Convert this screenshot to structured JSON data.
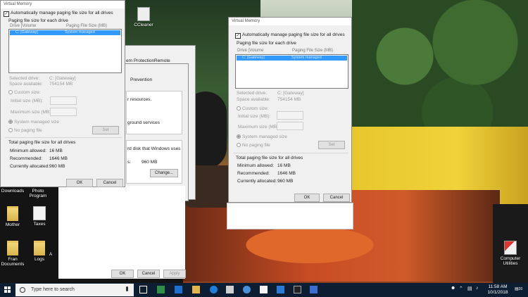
{
  "desktop": {
    "icons": [
      {
        "label": "CCleaner"
      },
      {
        "label": "Downloads"
      },
      {
        "label": "Photo Program"
      },
      {
        "label": "Mother"
      },
      {
        "label": "Taxes"
      },
      {
        "label": "Fran Documents"
      },
      {
        "label": "Logs"
      },
      {
        "label": "A"
      },
      {
        "label": "Computer Utilities"
      }
    ]
  },
  "vm_left": {
    "title": "Virtual Memory",
    "auto_manage": "Automatically manage paging file size for all drives",
    "group_label": "Paging file size for each drive",
    "col_drive": "Drive [Volume",
    "col_size": "Paging File Size (MB)",
    "list_drive": "C: [Gateway]",
    "list_size": "System managed",
    "selected_drive_label": "Selected drive:",
    "selected_drive_value": "C: [Gateway]",
    "space_label": "Space available:",
    "space_value": "754154 MB",
    "custom_size": "Custom size:",
    "initial_size": "Initial size (MB):",
    "max_size": "Maximum size (MB):",
    "system_managed": "System managed size",
    "no_paging": "No paging file",
    "set": "Set",
    "total_label": "Total paging file size for all drives",
    "min_label": "Minimum allowed:",
    "min_value": "16 MB",
    "rec_label": "Recommended:",
    "rec_value": "1646 MB",
    "alloc_label": "Currently allocated:",
    "alloc_value": "960 MB",
    "ok": "OK",
    "cancel": "Cancel"
  },
  "vm_right": {
    "title": "Virtual Memory",
    "auto_manage": "Automatically manage paging file size for all drives",
    "group_label": "Paging file size for each drive",
    "col_drive": "Drive [Volume",
    "col_size": "Paging File Size (MB)",
    "list_drive": "C: [Gateway]",
    "list_size": "System managed",
    "selected_drive_label": "Selected drive:",
    "selected_drive_value": "C: [Gateway]",
    "space_label": "Space available:",
    "space_value": "754154 MB",
    "custom_size": "Custom size:",
    "initial_size": "Initial size (MB):",
    "max_size": "Maximum size (MB):",
    "system_managed": "System managed size",
    "no_paging": "No paging file",
    "set": "Set",
    "total_label": "Total paging file size for all drives",
    "min_label": "Minimum allowed:",
    "min_value": "16 MB",
    "rec_label": "Recommended:",
    "rec_value": "1646 MB",
    "alloc_label": "Currently allocated:",
    "alloc_value": "960 MB",
    "ok": "OK",
    "cancel": "Cancel"
  },
  "sys_props": {
    "tab1": "em Protection",
    "tab2": "Remote"
  },
  "perf_options": {
    "tab": "Prevention",
    "line1": "r resources.",
    "line2": "ground services",
    "line3": "rd disk that Windows uses",
    "line4_prefix": "s:",
    "line4_value": "960 MB",
    "change": "Change...",
    "ok": "OK",
    "cancel": "Cancel",
    "apply": "Apply"
  },
  "taskbar": {
    "search_placeholder": "Type here to search",
    "time": "11:58 AM",
    "date": "10/1/2018",
    "notification_count": "20"
  }
}
